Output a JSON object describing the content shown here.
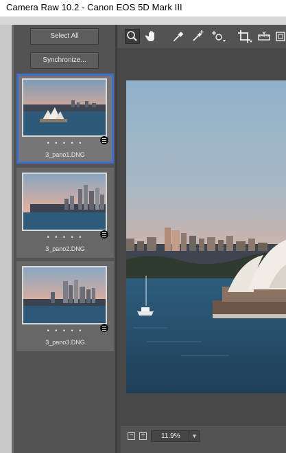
{
  "window": {
    "title": "Camera Raw 10.2  -  Canon EOS 5D Mark III"
  },
  "filmstrip": {
    "select_all_label": "Select All",
    "synchronize_label": "Synchronize...",
    "items": [
      {
        "filename": "3_pano1.DNG",
        "rating": "• • • • •",
        "selected": true
      },
      {
        "filename": "3_pano2.DNG",
        "rating": "• • • • •",
        "selected": false
      },
      {
        "filename": "3_pano3.DNG",
        "rating": "• • • • •",
        "selected": false
      }
    ]
  },
  "toolbar": {
    "tools": [
      "zoom-tool-icon",
      "hand-tool-icon",
      "white-balance-icon",
      "color-sampler-icon",
      "targeted-adjustment-icon",
      "crop-tool-icon",
      "straighten-tool-icon",
      "transform-tool-icon"
    ],
    "active_tool": "zoom-tool-icon"
  },
  "zoom": {
    "minus_label": "−",
    "plus_label": "+",
    "value": "11.9%"
  },
  "colors": {
    "selection_border": "#3a6fd1",
    "panel": "#535353"
  }
}
